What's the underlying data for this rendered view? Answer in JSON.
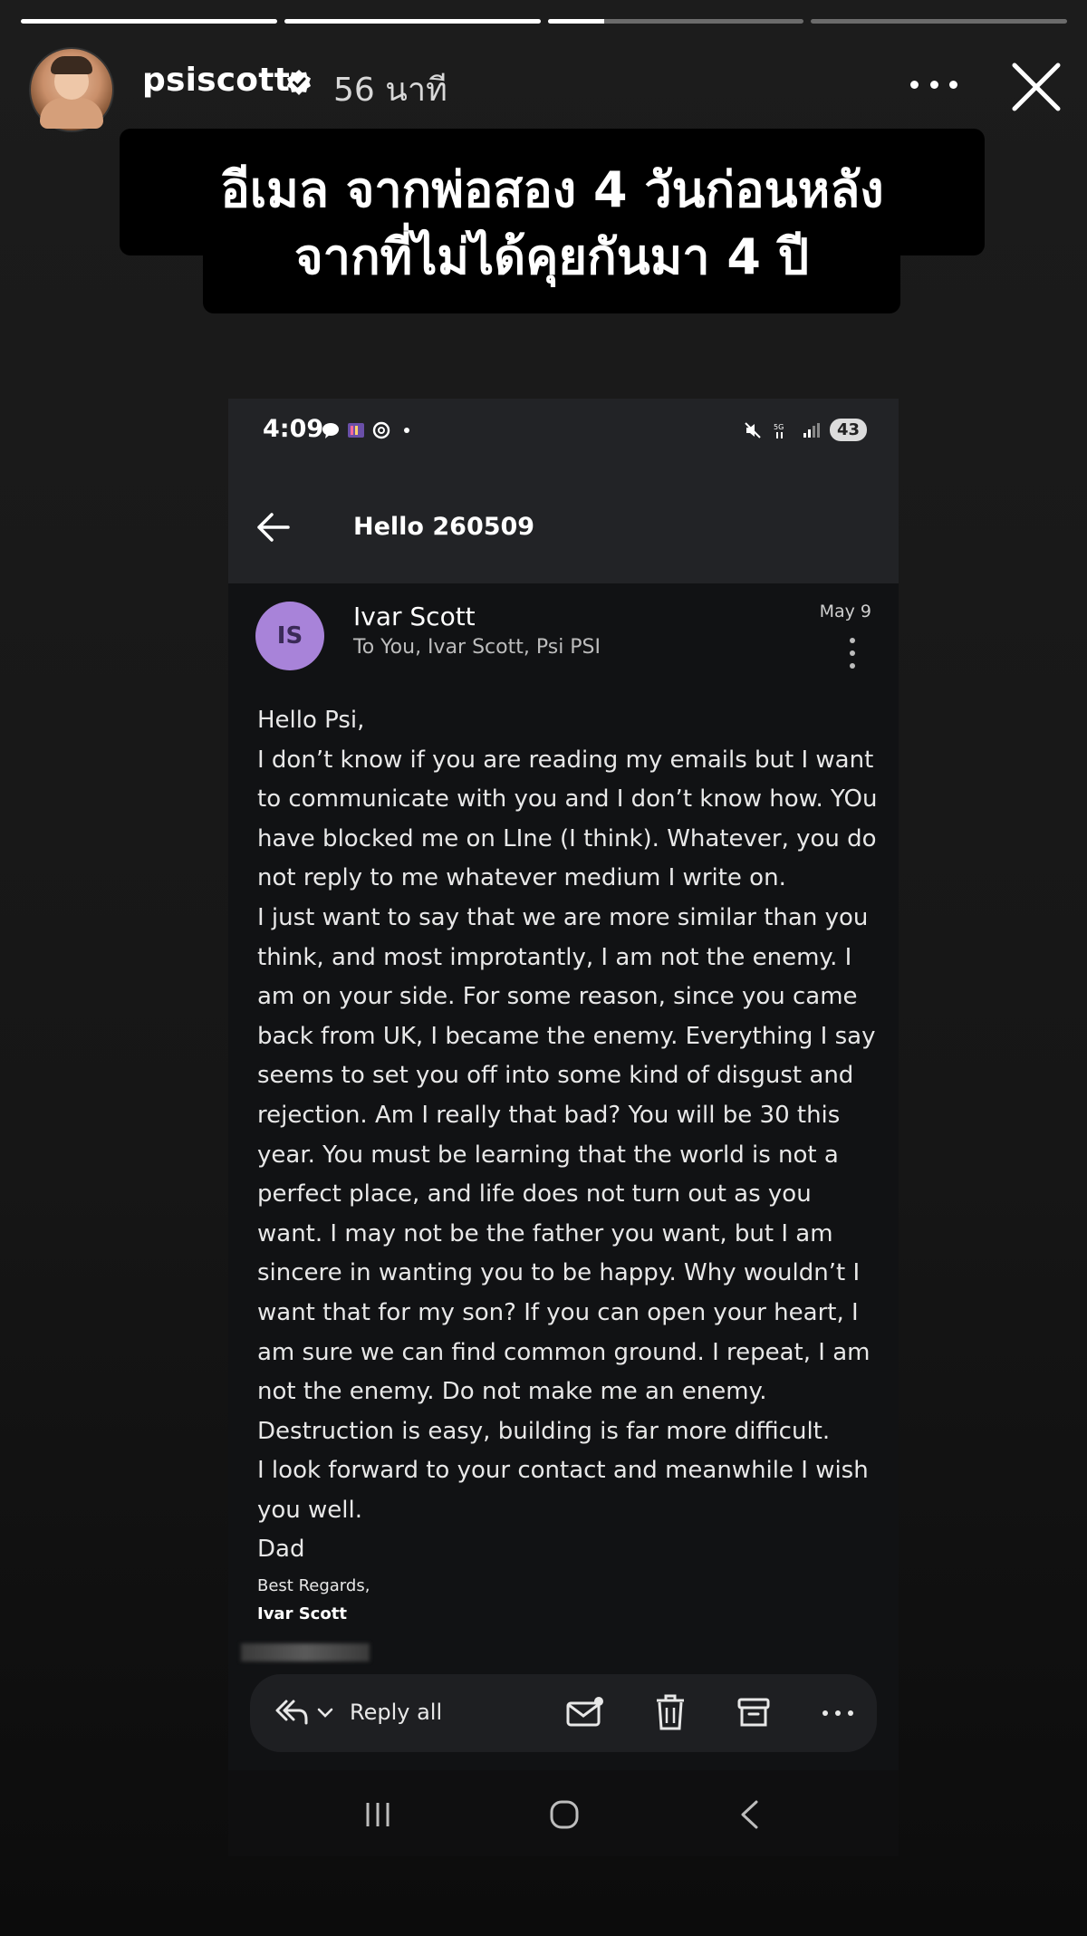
{
  "story": {
    "progress": [
      1.0,
      1.0,
      0.22,
      0.0
    ],
    "username": "psiscott",
    "time_ago": "56 นาที",
    "caption_line1": "อีเมล จากพ่อสอง 4 วันก่อนหลัง",
    "caption_line2": "จากที่ไม่ได้คุยกันมา 4 ปี"
  },
  "phone": {
    "status_time": "4:09",
    "battery": "43",
    "subject": "Hello 260509",
    "sender_initials": "IS",
    "sender_name": "Ivar Scott",
    "recipients": "To You, Ivar Scott, Psi PSI",
    "date": "May 9",
    "body": [
      "Hello Psi,",
      "I don’t know if you are reading my emails but I want to communicate with you and I don’t know how. YOu have blocked me on LIne (I think). Whatever, you do not reply to me whatever medium I write on.",
      "I just want to say that we are more similar than you think, and most improtantly, I am not the enemy. I am on your side. For some reason, since you came back from UK, I became the enemy. Everything I say seems to set you off into some kind of disgust and rejection. Am I really that bad? You will be 30 this year. You must be learning that the world is not a perfect place, and life does not turn out as you want. I may not be the father you want, but I am sincere in wanting you to be happy. Why wouldn’t I want that for my son? If you can open your heart, I am sure we can find common ground. I repeat, I am not the enemy. Do not make me an enemy. Destruction is easy, building is far more difficult.",
      "I look forward to your contact and meanwhile I wish you well.",
      "Dad"
    ],
    "signoff": "Best Regards,",
    "signature_name": "Ivar Scott",
    "reply_all_label": "Reply all"
  },
  "colors": {
    "background": "#151515",
    "avatar_purple": "#a883d9",
    "phone_bar": "#222326"
  },
  "icons": [
    "verified-icon",
    "more-icon",
    "close-icon",
    "back-arrow-icon",
    "reply-all-icon",
    "mark-unread-icon",
    "trash-icon",
    "archive-icon",
    "nav-recent-icon",
    "nav-home-icon",
    "nav-back-icon"
  ]
}
